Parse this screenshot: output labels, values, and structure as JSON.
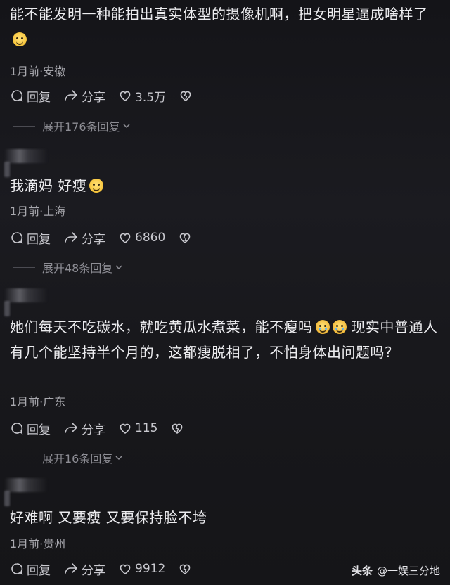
{
  "comments": [
    {
      "text": "能不能发明一种能拍出真实体型的摄像机啊，把女明星逼成啥样了",
      "emoji": "dizzy-face-emoji",
      "meta": "1月前·安徽",
      "reply_label": "回复",
      "share_label": "分享",
      "likes": "3.5万",
      "expand_label": "展开176条回复"
    },
    {
      "text": "我滴妈 好瘦",
      "emoji": "smiling-face-emoji",
      "meta": "1月前·上海",
      "reply_label": "回复",
      "share_label": "分享",
      "likes": "6860",
      "expand_label": "展开48条回复"
    },
    {
      "text_part1": "她们每天不吃碳水，就吃黄瓜水煮菜，能不瘦吗",
      "text_part2": "现实中普通人有几个能坚持半个月的，这都瘦脱相了，不怕身体出问题吗?",
      "emoji": "crying-laughing-emoji",
      "meta": "1月前·广东",
      "reply_label": "回复",
      "share_label": "分享",
      "likes": "115",
      "expand_label": "展开16条回复"
    },
    {
      "text": "好难啊 又要瘦 又要保持脸不垮",
      "meta": "1月前·贵州",
      "reply_label": "回复",
      "share_label": "分享",
      "likes": "9912"
    }
  ],
  "watermark": {
    "brand": "头条",
    "handle": "@一娱三分地"
  },
  "colors": {
    "background": "#16161a",
    "text": "#ececef",
    "meta": "#a8a8ae",
    "expand": "#8d8d94"
  }
}
